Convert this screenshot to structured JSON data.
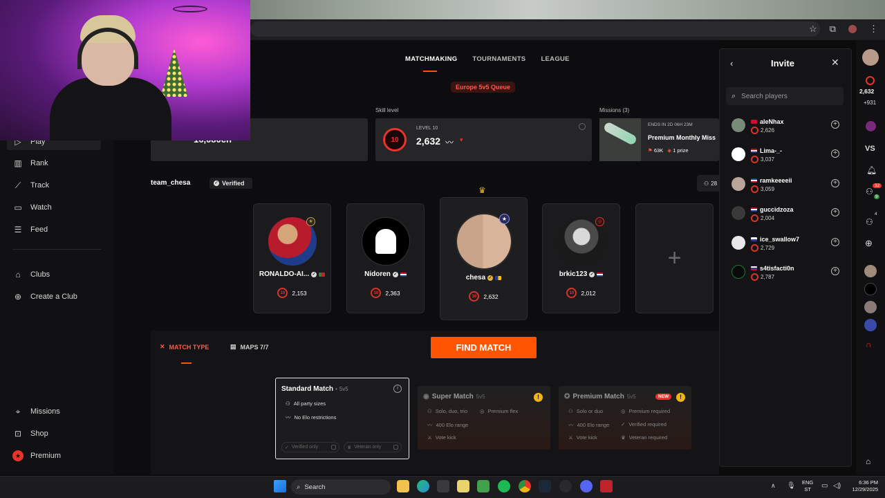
{
  "browser": {
    "star_icon": "star-icon",
    "extensions_icon": "puzzle-icon",
    "menu_icon": "kebab-icon"
  },
  "nav": {
    "top_items": [
      {
        "label": "Play",
        "icon": "play-icon"
      },
      {
        "label": "Rank",
        "icon": "bar-chart-icon"
      },
      {
        "label": "Track",
        "icon": "trend-icon"
      },
      {
        "label": "Watch",
        "icon": "video-icon"
      },
      {
        "label": "Feed",
        "icon": "feed-icon"
      }
    ],
    "club_items": [
      {
        "label": "Clubs",
        "icon": "clubs-icon"
      },
      {
        "label": "Create a Club",
        "icon": "plus-circle-icon"
      }
    ],
    "bottom_items": [
      {
        "label": "Missions",
        "icon": "missions-icon"
      },
      {
        "label": "Shop",
        "icon": "shop-icon"
      },
      {
        "label": "Premium",
        "icon": "premium-icon"
      }
    ]
  },
  "tabs": [
    {
      "label": "MATCHMAKING"
    },
    {
      "label": "TOURNAMENTS"
    },
    {
      "label": "LEAGUE"
    }
  ],
  "queue_label": "Europe 5v5 Queue",
  "stats": {
    "left_value": "16,080ch",
    "skill_label": "Skill level",
    "level_tag": "LEVEL 10",
    "level_num": "10",
    "elo": "2,632",
    "missions_label": "Missions (3)",
    "mission_ends": "ENDS IN 2D 06H 23M",
    "mission_title": "Premium Monthly Miss",
    "mission_points": "63K",
    "mission_prize": "1 prize"
  },
  "team": {
    "name": "team_chesa",
    "verified_label": "Verified",
    "members_count": "28"
  },
  "players": [
    {
      "name": "RONALDO-AI...",
      "elo": "2,153",
      "level": "10",
      "flag": [
        "#c0242b",
        "#1f8a3a"
      ]
    },
    {
      "name": "Nidoren",
      "elo": "2,363",
      "level": "10",
      "flag": [
        "#c8102e",
        "#2b3c8f"
      ]
    },
    {
      "name": "chesa",
      "elo": "2,632",
      "level": "10",
      "flag": [
        "#2b3c8f",
        "#f7c600"
      ]
    },
    {
      "name": "brkic123",
      "elo": "2,012",
      "level": "10",
      "flag": [
        "#c8102e",
        "#2b3c8f"
      ]
    }
  ],
  "bottom": {
    "match_type_label": "MATCH TYPE",
    "maps_label": "MAPS 7/7",
    "find_match_label": "FIND MATCH"
  },
  "modes": [
    {
      "title": "Standard Match",
      "sub": "5v5",
      "features": [
        "All party sizes",
        "No Elo restrictions"
      ],
      "toggles": [
        "Verified only",
        "Veteran only"
      ]
    },
    {
      "title": "Super Match",
      "sub": "5v5",
      "left": [
        "Solo, duo, trio",
        "400 Elo range",
        "Vote kick"
      ],
      "right": [
        "Premium flex"
      ]
    },
    {
      "title": "Premium Match",
      "sub": "5v5",
      "badge": "NEW",
      "left": [
        "Solo or duo",
        "400 Elo range",
        "Vote kick"
      ],
      "right": [
        "Premium required",
        "Verified required",
        "Veteran required"
      ]
    }
  ],
  "invite": {
    "title": "Invite",
    "search_placeholder": "Search players",
    "rows": [
      {
        "name": "aleNhax",
        "elo": "2,626"
      },
      {
        "name": "Lima-_-",
        "elo": "3,037"
      },
      {
        "name": "ramkeeeeii",
        "elo": "3,059"
      },
      {
        "name": "guccidzoza",
        "elo": "2,004"
      },
      {
        "name": "ice_swallow7",
        "elo": "2,729"
      },
      {
        "name": "s4tisfacti0n",
        "elo": "2,787"
      }
    ]
  },
  "rightbar": {
    "elo": "2,632",
    "delta": "+931",
    "vs": "VS",
    "badge1": "32",
    "badge2": "9",
    "badge3": "4"
  },
  "taskbar": {
    "search_label": "Search",
    "lang1": "ENG",
    "lang2": "ST",
    "time": "6:36 PM",
    "date": "12/29/2025"
  }
}
